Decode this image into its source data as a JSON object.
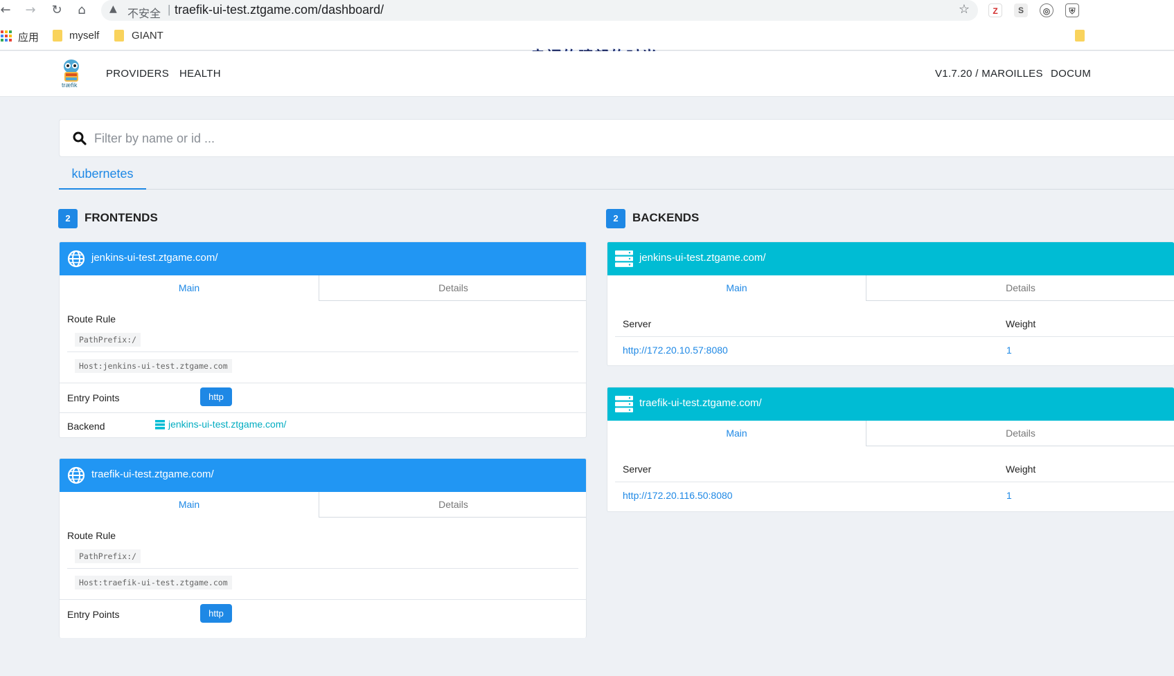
{
  "browser": {
    "insecure_label": "不安全",
    "separator": "|",
    "url": "traefik-ui-test.ztgame.com/dashboard/",
    "bookmarks": [
      {
        "label": "应用"
      },
      {
        "label": "myself"
      },
      {
        "label": "GIANT"
      }
    ],
    "banner_text": "幸福的晴朗的时光",
    "extensions": [
      {
        "letter": "Z",
        "color": "#d32f2f"
      },
      {
        "letter": "S",
        "color": "#555555"
      },
      {
        "letter": "◎",
        "color": "#555555"
      },
      {
        "letter": "⛨",
        "color": "#555555"
      }
    ]
  },
  "header": {
    "logo_text": "træfik",
    "nav": [
      "PROVIDERS",
      "HEALTH"
    ],
    "version": "V1.7.20 / MAROILLES",
    "docs": "DOCUM"
  },
  "search": {
    "placeholder": "Filter by name or id ..."
  },
  "providers": {
    "active_tab": "kubernetes"
  },
  "frontends": {
    "count": "2",
    "title": "FRONTENDS",
    "items": [
      {
        "name": "jenkins-ui-test.ztgame.com/",
        "tabs": [
          "Main",
          "Details"
        ],
        "route_rule_label": "Route Rule",
        "routes": [
          "PathPrefix:/",
          "Host:jenkins-ui-test.ztgame.com"
        ],
        "entry_points_label": "Entry Points",
        "entry_points": [
          "http"
        ],
        "backend_label": "Backend",
        "backend": "jenkins-ui-test.ztgame.com/"
      },
      {
        "name": "traefik-ui-test.ztgame.com/",
        "tabs": [
          "Main",
          "Details"
        ],
        "route_rule_label": "Route Rule",
        "routes": [
          "PathPrefix:/",
          "Host:traefik-ui-test.ztgame.com"
        ],
        "entry_points_label": "Entry Points",
        "entry_points": [
          "http"
        ]
      }
    ]
  },
  "backends": {
    "count": "2",
    "title": "BACKENDS",
    "items": [
      {
        "name": "jenkins-ui-test.ztgame.com/",
        "tabs": [
          "Main",
          "Details"
        ],
        "server_label": "Server",
        "weight_label": "Weight",
        "servers": [
          {
            "url": "http://172.20.10.57:8080",
            "weight": "1"
          }
        ]
      },
      {
        "name": "traefik-ui-test.ztgame.com/",
        "tabs": [
          "Main",
          "Details"
        ],
        "server_label": "Server",
        "weight_label": "Weight",
        "servers": [
          {
            "url": "http://172.20.116.50:8080",
            "weight": "1"
          }
        ]
      }
    ]
  },
  "colors": {
    "accent": "#1e88e5",
    "frontend_header": "#2196f3",
    "backend_header": "#00bcd4",
    "page_bg": "#eef1f5"
  }
}
